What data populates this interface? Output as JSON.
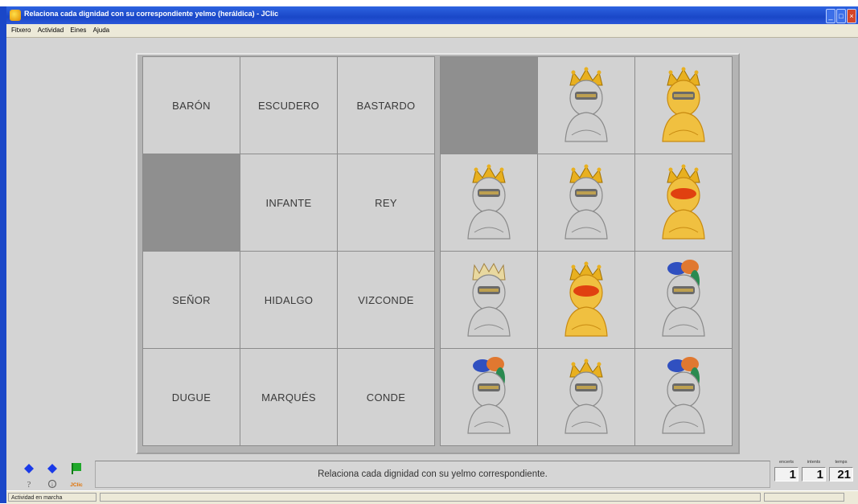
{
  "window": {
    "title": "Relaciona cada dignidad con su correspondiente yelmo (heráldica) - JClic",
    "buttons": {
      "minimize": "_",
      "maximize": "□",
      "close": "×"
    }
  },
  "menu": {
    "items": [
      "Fitxero",
      "Actividad",
      "Eines",
      "Ajuda"
    ]
  },
  "board": {
    "left_cells": [
      "BARÓN",
      "ESCUDERO",
      "BASTARDO",
      "",
      "INFANTE",
      "REY",
      "SEÑOR",
      "HIDALGO",
      "VIZCONDE",
      "DUGUE",
      "MARQUÉS",
      "CONDE"
    ],
    "right_cells": [
      "empty",
      "helmet-crown-silver",
      "helmet-crown-gold",
      "helmet-crown-silver",
      "helmet-crown-silver",
      "helmet-crown-gold-red",
      "helmet-coronet-silver",
      "helmet-crown-gold-red",
      "helmet-plumed-silver",
      "helmet-plumed-silver",
      "helmet-crown-silver",
      "helmet-plumed-silver"
    ]
  },
  "controls": {
    "help_label": "?",
    "info_label": "i",
    "logo_label": "JClic"
  },
  "message": "Relaciona cada dignidad con su yelmo correspondiente.",
  "counters": [
    {
      "label": "encerts",
      "value": "1"
    },
    {
      "label": "intents",
      "value": "1"
    },
    {
      "label": "temps",
      "value": "21"
    }
  ],
  "statusbar": {
    "text": "Actividad en marcha"
  },
  "colors": {
    "title_bar": "#1a47c8",
    "board_bg": "#b4b4b4",
    "cell_bg": "#d2d2d2",
    "empty_cell": "#8f8f8f",
    "gold": "#e8b020",
    "silver": "#c8c8c8",
    "red": "#e04010"
  }
}
